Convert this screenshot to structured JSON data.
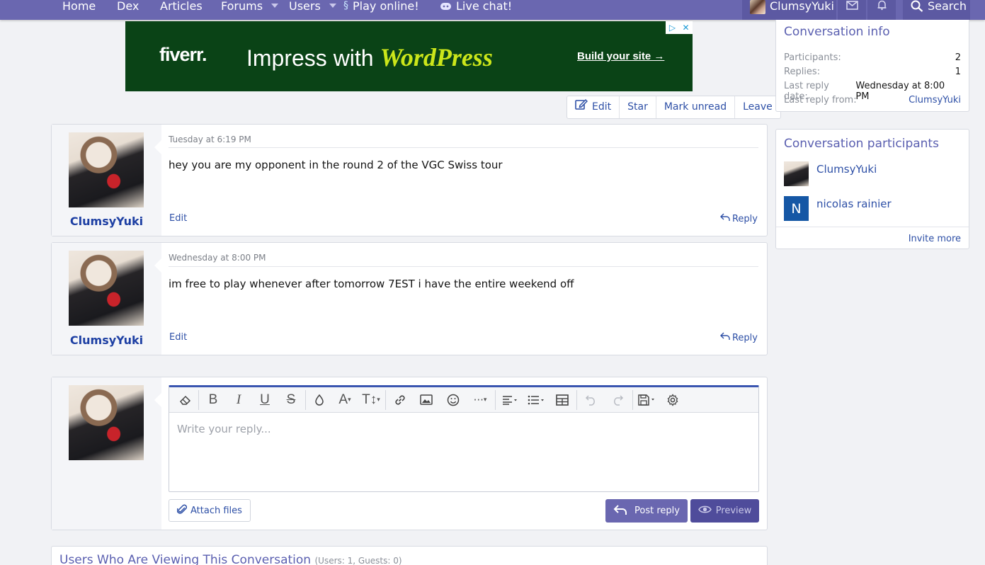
{
  "nav": {
    "items": [
      {
        "label": "Home"
      },
      {
        "label": "Dex"
      },
      {
        "label": "Articles"
      },
      {
        "label": "Forums"
      },
      {
        "label": "Users"
      },
      {
        "label": "Play online!"
      },
      {
        "label": "Live chat!"
      }
    ],
    "username": "ClumsyYuki",
    "search_label": "Search"
  },
  "ad": {
    "brand": "fiverr.",
    "headline": "Impress with ",
    "headline_highlight": "WordPress",
    "cta": "Build your site →"
  },
  "actions": {
    "edit": "Edit",
    "star": "Star",
    "mark_unread": "Mark unread",
    "leave": "Leave"
  },
  "messages": [
    {
      "author": "ClumsyYuki",
      "date": "Tuesday at 6:19 PM",
      "text": "hey you are my opponent in the round 2 of the VGC Swiss tour",
      "edit": "Edit",
      "reply": "Reply"
    },
    {
      "author": "ClumsyYuki",
      "date": "Wednesday at 8:00 PM",
      "text": "im free to play whenever after tomorrow 7EST i have the entire weekend off",
      "edit": "Edit",
      "reply": "Reply"
    }
  ],
  "editor": {
    "placeholder": "Write your reply...",
    "attach": "Attach files",
    "post": "Post reply",
    "preview": "Preview",
    "toolbar_icons": [
      "eraser-icon",
      "bold-icon",
      "italic-icon",
      "underline-icon",
      "strikethrough-icon",
      "color-icon",
      "font-family-icon",
      "font-size-icon",
      "link-icon",
      "image-icon",
      "emoji-icon",
      "more-icon",
      "align-icon",
      "list-icon",
      "table-icon",
      "undo-icon",
      "redo-icon",
      "drafts-icon",
      "settings-icon"
    ]
  },
  "info": {
    "title": "Conversation info",
    "rows": [
      {
        "label": "Participants:",
        "value": "2"
      },
      {
        "label": "Replies:",
        "value": "1"
      },
      {
        "label": "Last reply date:",
        "value": "Wednesday at 8:00 PM"
      },
      {
        "label": "Last reply from:",
        "value": "ClumsyYuki"
      }
    ]
  },
  "participants": {
    "title": "Conversation participants",
    "list": [
      {
        "name": "ClumsyYuki",
        "initial": ""
      },
      {
        "name": "nicolas rainier",
        "initial": "N"
      }
    ],
    "invite": "Invite more"
  },
  "viewers": {
    "title": "Users Who Are Viewing This Conversation",
    "count": "(Users: 1, Guests: 0)"
  },
  "colors": {
    "nav": "#6a67b0",
    "link": "#2d4fa6",
    "accent_title": "#5a5fb0",
    "ad_bg": "#0a4316"
  }
}
